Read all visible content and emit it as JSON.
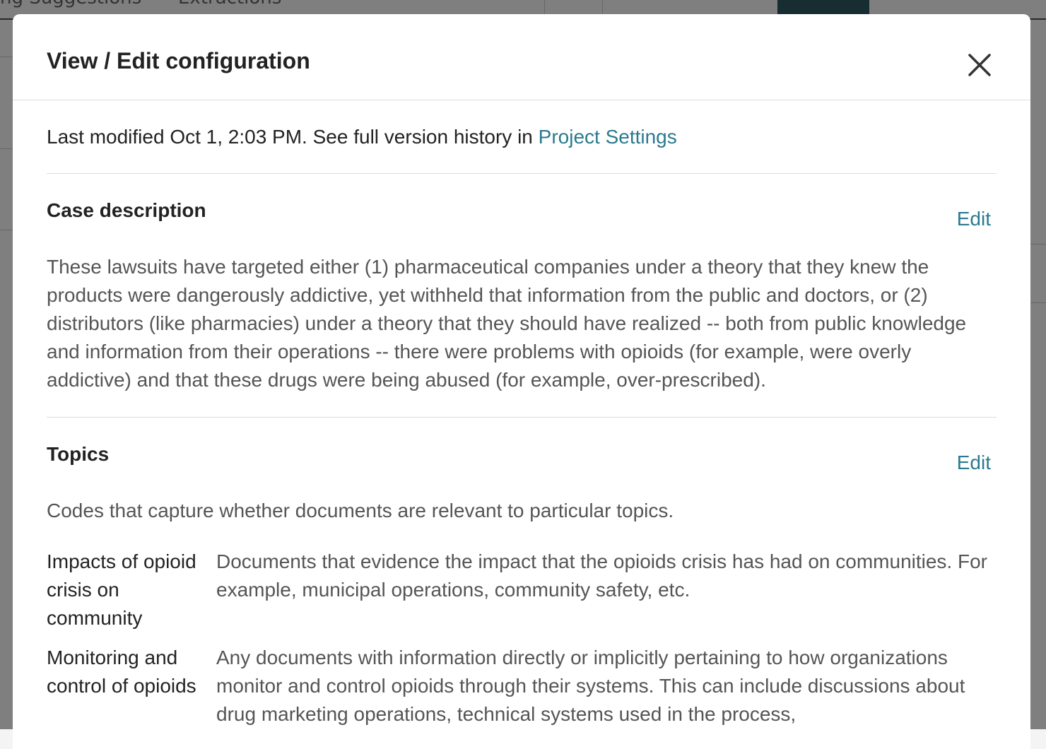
{
  "background": {
    "tabs": [
      "ng Suggestions",
      "Extractions"
    ]
  },
  "modal": {
    "title": "View / Edit configuration",
    "close_icon": "close-icon",
    "meta": {
      "text": "Last modified Oct 1, 2:03 PM. See full version history in ",
      "link": "Project Settings"
    },
    "case_description": {
      "title": "Case description",
      "edit_label": "Edit",
      "text": "These lawsuits have targeted either (1) pharmaceutical companies under a theory that they knew the products were dangerously addictive, yet withheld that information from the public and doctors, or (2) distributors (like pharmacies) under a theory that they should have realized -- both from public knowledge and information from their operations -- there were problems with opioids (for example, were overly addictive) and that these drugs were being abused (for example, over-prescribed)."
    },
    "topics": {
      "title": "Topics",
      "edit_label": "Edit",
      "description": "Codes that capture whether documents are relevant to particular topics.",
      "items": [
        {
          "name": "Impacts of opioid crisis on community",
          "description": "Documents that evidence the impact that the opioids crisis has had on communities. For example, municipal operations, community safety, etc."
        },
        {
          "name": "Monitoring and control of opioids",
          "description": "Any documents with information directly or implicitly pertaining to how organizations monitor and control opioids through their systems. This can include discussions about drug marketing operations, technical systems used in the process,"
        }
      ]
    }
  }
}
